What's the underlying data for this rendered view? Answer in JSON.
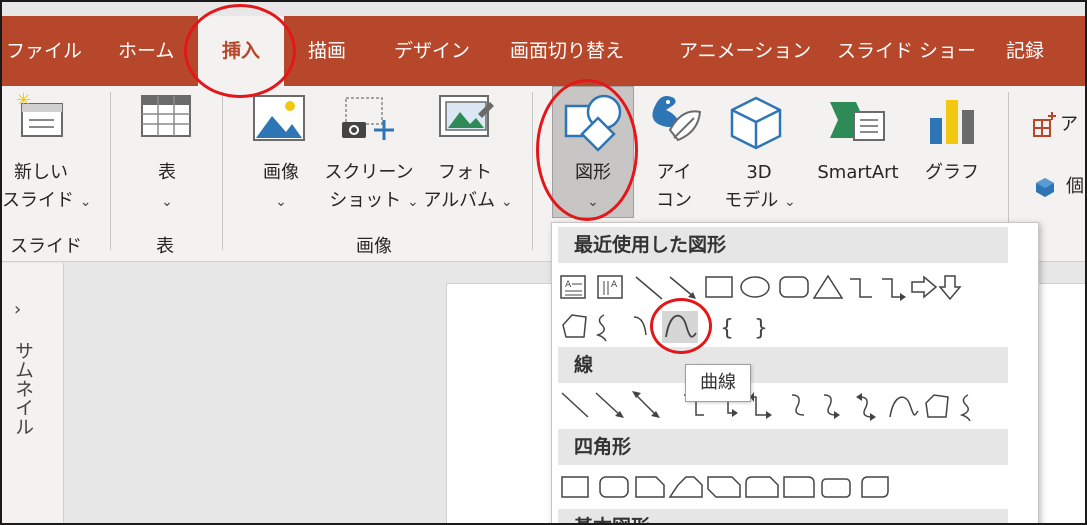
{
  "tabs": [
    {
      "label": "ファイル"
    },
    {
      "label": "ホーム"
    },
    {
      "label": "挿入"
    },
    {
      "label": "描画"
    },
    {
      "label": "デザイン"
    },
    {
      "label": "画面切り替え"
    },
    {
      "label": "アニメーション"
    },
    {
      "label": "スライド ショー"
    },
    {
      "label": "記録"
    }
  ],
  "ribbon": {
    "new_slide_line1": "新しい",
    "new_slide_line2": "スライド",
    "table": "表",
    "image": "画像",
    "screenshot_line1": "スクリーン",
    "screenshot_line2": "ショット",
    "photo_line1": "フォト",
    "photo_line2": "アルバム",
    "shapes": "図形",
    "icons_line1": "アイ",
    "icons_line2": "コン",
    "model3d_line1": "3D",
    "model3d_line2": "モデル",
    "smartart": "SmartArt",
    "chart": "グラフ",
    "addin_partial": "ア",
    "personal_partial": "個",
    "chevron": "⌄",
    "group_slides": "スライド",
    "group_table": "表",
    "group_images": "画像"
  },
  "left_pane": {
    "label": "サムネイル",
    "chevron": "›"
  },
  "shapes_gallery": {
    "section_recent": "最近使用した図形",
    "section_lines": "線",
    "section_rectangles": "四角形",
    "section_basic": "基本図形",
    "tooltip": "曲線"
  },
  "colors": {
    "accent": "#b7472a",
    "annotation": "#e3171a",
    "ribbon_bg": "#f3f2f1",
    "workspace_bg": "#e7e7e7"
  }
}
